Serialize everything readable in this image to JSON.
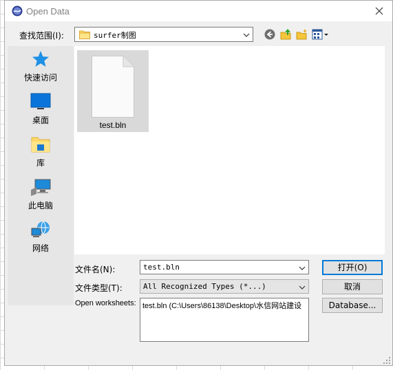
{
  "window": {
    "title": "Open Data",
    "icon": "surfer-app-icon"
  },
  "lookin": {
    "label": "查找范围(I):",
    "value": "surfer制图"
  },
  "toolbar": {
    "icons": [
      "back-arrow-icon",
      "up-folder-icon",
      "new-folder-icon",
      "view-menu-icon"
    ]
  },
  "places": [
    {
      "label": "快速访问",
      "icon": "quick-access-star-icon"
    },
    {
      "label": "桌面",
      "icon": "desktop-icon"
    },
    {
      "label": "库",
      "icon": "library-icon"
    },
    {
      "label": "此电脑",
      "icon": "this-pc-icon"
    },
    {
      "label": "网络",
      "icon": "network-icon"
    }
  ],
  "files": [
    {
      "name": "test.bln",
      "icon": "blank-document-icon",
      "selected": true
    }
  ],
  "filename": {
    "label": "文件名(N):",
    "value": "test.bln"
  },
  "filetype": {
    "label": "文件类型(T):",
    "value": "All Recognized Types (*...)"
  },
  "worksheets": {
    "label": "Open worksheets:",
    "value": "test.bln (C:\\Users\\86138\\Desktop\\水信网站建设"
  },
  "buttons": {
    "open": "打开(O)",
    "cancel": "取消",
    "database": "Database..."
  },
  "colors": {
    "accent": "#0078d7",
    "selection": "#d9d9d9",
    "dialog_bg": "#f0f0f0"
  }
}
